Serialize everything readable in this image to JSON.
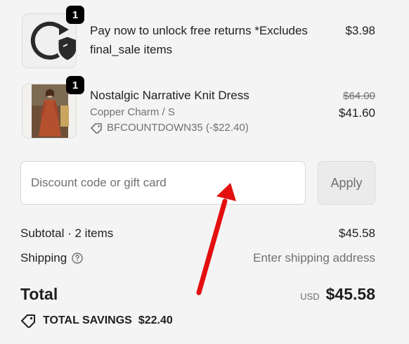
{
  "items": [
    {
      "title": "Pay now to unlock free returns *Excludes final_sale items",
      "quantity": "1",
      "price": "$3.98"
    },
    {
      "title": "Nostalgic Narrative Knit Dress",
      "variant": "Copper Charm / S",
      "discount": "BFCOUNTDOWN35 (-$22.40)",
      "quantity": "1",
      "original_price": "$64.00",
      "price": "$41.60"
    }
  ],
  "discount": {
    "placeholder": "Discount code or gift card",
    "apply_label": "Apply"
  },
  "summary": {
    "subtotal_label": "Subtotal · 2 items",
    "subtotal_value": "$45.58",
    "shipping_label": "Shipping",
    "shipping_value": "Enter shipping address",
    "total_label": "Total",
    "currency": "USD",
    "total_value": "$45.58",
    "savings_label": "TOTAL SAVINGS",
    "savings_value": "$22.40"
  },
  "colors": {
    "background": "#f4f4f4",
    "annotation_arrow": "#e30f0f"
  }
}
